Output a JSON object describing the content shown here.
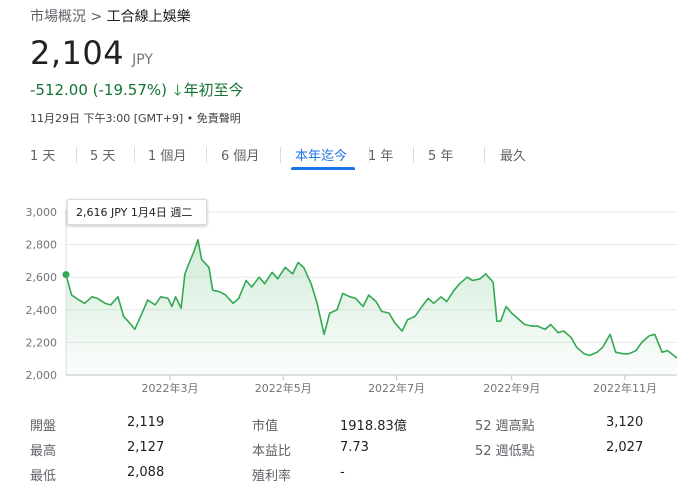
{
  "breadcrumb": {
    "parent": "市場概況",
    "separator": ">",
    "current": "工合線上娛樂"
  },
  "quote": {
    "price": "2,104",
    "currency": "JPY",
    "change": "-512.00 (-19.57%)",
    "change_arrow": "🡓",
    "change_period": "年初至今",
    "timestamp": "11月29日 下午3:00 [GMT+9] • 免責聲明"
  },
  "tabs": [
    {
      "label": "1 天"
    },
    {
      "label": "5 天"
    },
    {
      "label": "1 個月"
    },
    {
      "label": "6 個月"
    },
    {
      "label": "本年迄今"
    },
    {
      "label": "1 年"
    },
    {
      "label": "5 年"
    },
    {
      "label": "最久"
    }
  ],
  "active_tab": "本年迄今",
  "tooltip": {
    "text": "2,616 JPY  1月4日 週二"
  },
  "chart_data": {
    "type": "area",
    "title": "",
    "xlabel": "",
    "ylabel": "",
    "ylim": [
      2000,
      3000
    ],
    "yticks": [
      2000,
      2200,
      2400,
      2600,
      2800,
      3000
    ],
    "ytick_labels": [
      "2,000",
      "2,200",
      "2,400",
      "2,600",
      "2,800",
      "3,000"
    ],
    "xticks": [
      {
        "label": "2022年3月",
        "x": "2022-03-01"
      },
      {
        "label": "2022年5月",
        "x": "2022-05-01"
      },
      {
        "label": "2022年7月",
        "x": "2022-07-01"
      },
      {
        "label": "2022年9月",
        "x": "2022-09-01"
      },
      {
        "label": "2022年11月",
        "x": "2022-11-01"
      }
    ],
    "grid": true,
    "line_color": "#34a853",
    "highlight_point": {
      "x": "2022-01-04",
      "y": 2616
    },
    "series": [
      {
        "points": [
          [
            "2022-01-04",
            2616
          ],
          [
            "2022-01-07",
            2490
          ],
          [
            "2022-01-11",
            2460
          ],
          [
            "2022-01-14",
            2440
          ],
          [
            "2022-01-18",
            2480
          ],
          [
            "2022-01-21",
            2470
          ],
          [
            "2022-01-25",
            2440
          ],
          [
            "2022-01-28",
            2430
          ],
          [
            "2022-02-01",
            2480
          ],
          [
            "2022-02-04",
            2360
          ],
          [
            "2022-02-08",
            2310
          ],
          [
            "2022-02-10",
            2280
          ],
          [
            "2022-02-14",
            2380
          ],
          [
            "2022-02-17",
            2460
          ],
          [
            "2022-02-21",
            2430
          ],
          [
            "2022-02-24",
            2480
          ],
          [
            "2022-02-28",
            2470
          ],
          [
            "2022-03-02",
            2420
          ],
          [
            "2022-03-04",
            2480
          ],
          [
            "2022-03-07",
            2410
          ],
          [
            "2022-03-09",
            2620
          ],
          [
            "2022-03-11",
            2680
          ],
          [
            "2022-03-14",
            2760
          ],
          [
            "2022-03-16",
            2830
          ],
          [
            "2022-03-18",
            2710
          ],
          [
            "2022-03-22",
            2660
          ],
          [
            "2022-03-24",
            2520
          ],
          [
            "2022-03-28",
            2510
          ],
          [
            "2022-03-31",
            2490
          ],
          [
            "2022-04-04",
            2440
          ],
          [
            "2022-04-07",
            2470
          ],
          [
            "2022-04-11",
            2580
          ],
          [
            "2022-04-14",
            2540
          ],
          [
            "2022-04-18",
            2600
          ],
          [
            "2022-04-21",
            2560
          ],
          [
            "2022-04-25",
            2630
          ],
          [
            "2022-04-28",
            2590
          ],
          [
            "2022-05-02",
            2660
          ],
          [
            "2022-05-06",
            2620
          ],
          [
            "2022-05-09",
            2690
          ],
          [
            "2022-05-12",
            2660
          ],
          [
            "2022-05-16",
            2560
          ],
          [
            "2022-05-19",
            2450
          ],
          [
            "2022-05-23",
            2250
          ],
          [
            "2022-05-26",
            2380
          ],
          [
            "2022-05-30",
            2400
          ],
          [
            "2022-06-02",
            2500
          ],
          [
            "2022-06-06",
            2480
          ],
          [
            "2022-06-09",
            2470
          ],
          [
            "2022-06-13",
            2420
          ],
          [
            "2022-06-16",
            2490
          ],
          [
            "2022-06-20",
            2450
          ],
          [
            "2022-06-23",
            2390
          ],
          [
            "2022-06-27",
            2380
          ],
          [
            "2022-06-30",
            2320
          ],
          [
            "2022-07-04",
            2270
          ],
          [
            "2022-07-07",
            2340
          ],
          [
            "2022-07-11",
            2360
          ],
          [
            "2022-07-14",
            2410
          ],
          [
            "2022-07-18",
            2470
          ],
          [
            "2022-07-21",
            2440
          ],
          [
            "2022-07-25",
            2480
          ],
          [
            "2022-07-28",
            2450
          ],
          [
            "2022-08-01",
            2520
          ],
          [
            "2022-08-04",
            2560
          ],
          [
            "2022-08-08",
            2600
          ],
          [
            "2022-08-11",
            2580
          ],
          [
            "2022-08-15",
            2590
          ],
          [
            "2022-08-18",
            2620
          ],
          [
            "2022-08-22",
            2570
          ],
          [
            "2022-08-24",
            2330
          ],
          [
            "2022-08-26",
            2330
          ],
          [
            "2022-08-29",
            2420
          ],
          [
            "2022-09-01",
            2380
          ],
          [
            "2022-09-05",
            2340
          ],
          [
            "2022-09-08",
            2310
          ],
          [
            "2022-09-12",
            2300
          ],
          [
            "2022-09-15",
            2300
          ],
          [
            "2022-09-19",
            2280
          ],
          [
            "2022-09-22",
            2310
          ],
          [
            "2022-09-26",
            2260
          ],
          [
            "2022-09-29",
            2270
          ],
          [
            "2022-10-03",
            2230
          ],
          [
            "2022-10-06",
            2170
          ],
          [
            "2022-10-10",
            2130
          ],
          [
            "2022-10-13",
            2120
          ],
          [
            "2022-10-17",
            2140
          ],
          [
            "2022-10-20",
            2170
          ],
          [
            "2022-10-24",
            2250
          ],
          [
            "2022-10-27",
            2140
          ],
          [
            "2022-10-31",
            2130
          ],
          [
            "2022-11-03",
            2130
          ],
          [
            "2022-11-07",
            2150
          ],
          [
            "2022-11-10",
            2200
          ],
          [
            "2022-11-14",
            2240
          ],
          [
            "2022-11-17",
            2250
          ],
          [
            "2022-11-21",
            2140
          ],
          [
            "2022-11-24",
            2150
          ],
          [
            "2022-11-29",
            2104
          ]
        ]
      }
    ]
  },
  "stats": {
    "col1": [
      {
        "label": "開盤",
        "value": "2,119"
      },
      {
        "label": "最高",
        "value": "2,127"
      },
      {
        "label": "最低",
        "value": "2,088"
      }
    ],
    "col2": [
      {
        "label": "市值",
        "value": "1918.83億"
      },
      {
        "label": "本益比",
        "value": "7.73"
      },
      {
        "label": "殖利率",
        "value": "-"
      }
    ],
    "col3": [
      {
        "label": "52 週高點",
        "value": "3,120"
      },
      {
        "label": "52 週低點",
        "value": "2,027"
      }
    ]
  }
}
